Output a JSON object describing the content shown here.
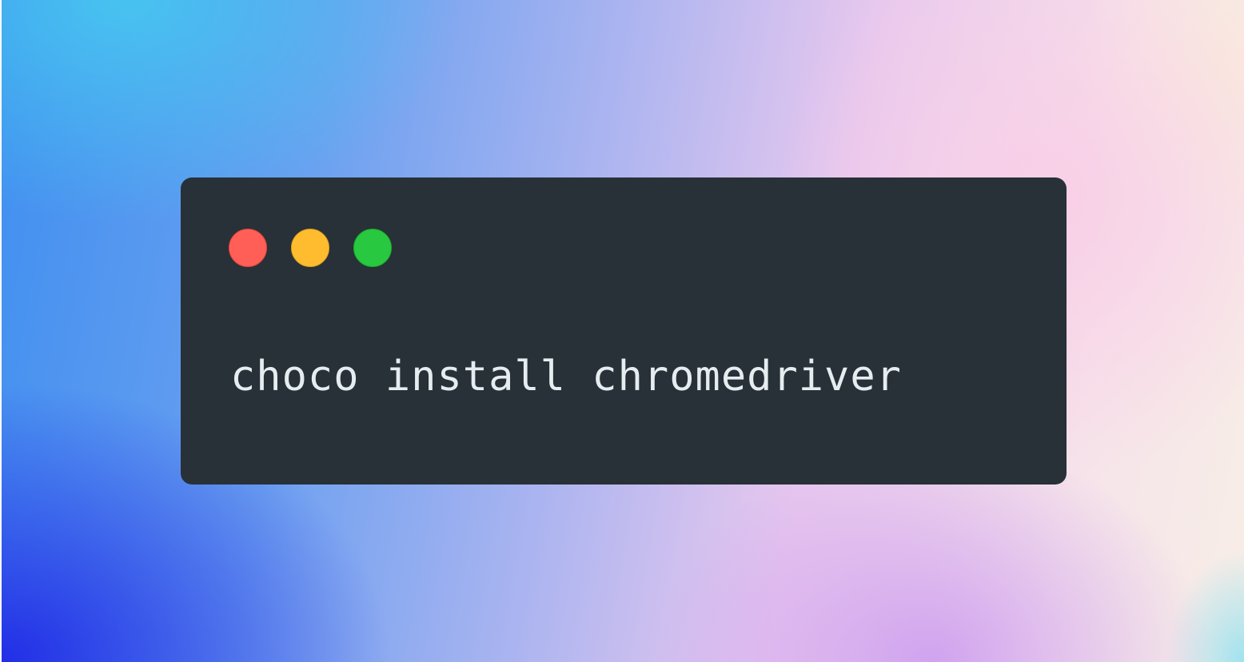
{
  "terminal": {
    "command": "choco install chromedriver",
    "window_controls": [
      "close",
      "minimize",
      "maximize"
    ]
  },
  "colors": {
    "window_bg": "#283137",
    "text": "#e6edf1",
    "close": "#ff5f57",
    "minimize": "#febc2e",
    "maximize": "#28c840"
  }
}
